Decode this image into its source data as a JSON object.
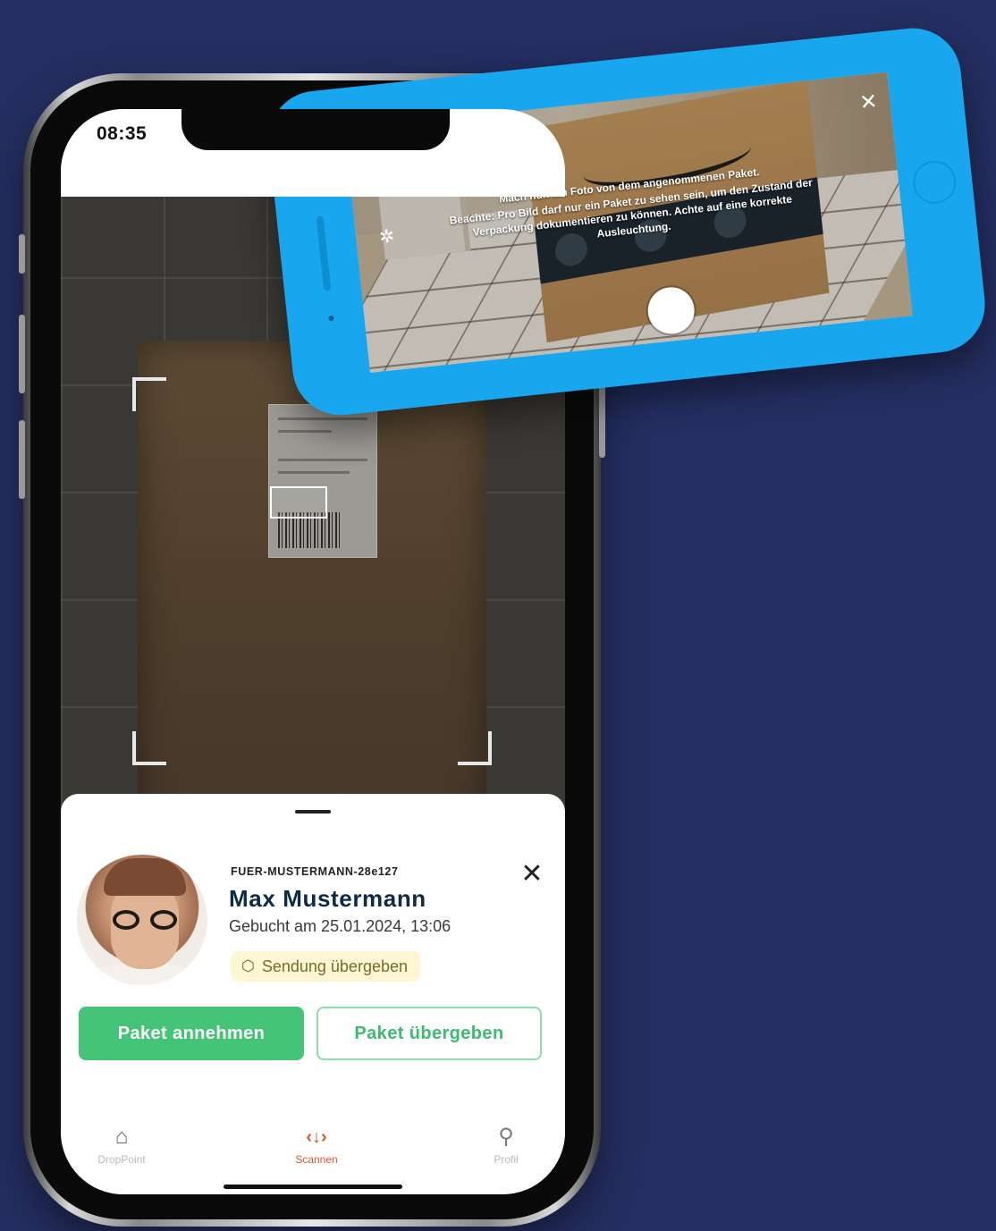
{
  "portrait_app": {
    "status_bar": {
      "time": "08:35"
    },
    "sheet": {
      "booking_id": "FUER-MUSTERMANN-28e127",
      "recipient_name": "Max Mustermann",
      "booked_at": "Gebucht am 25.01.2024, 13:06",
      "status_badge": {
        "icon": "package-icon",
        "label": "Sendung übergeben"
      },
      "close_icon": "close-icon",
      "buttons": {
        "accept": "Paket annehmen",
        "hand_over": "Paket übergeben"
      }
    },
    "tab_bar": {
      "items": [
        {
          "label": "DropPoint",
          "icon": "inbox-icon",
          "active": false
        },
        {
          "label": "Scannen",
          "icon": "scan-icon",
          "active": true
        },
        {
          "label": "Profil",
          "icon": "person-icon",
          "active": false
        }
      ]
    }
  },
  "landscape_app": {
    "instruction_line_1": "Mach nun ein Foto von dem angenommenen Paket.",
    "instruction_line_2": "Beachte: Pro Bild darf nur ein Paket zu sehen sein, um den Zustand der Verpackung dokumentieren zu können. Achte auf eine korrekte Ausleuchtung.",
    "close_icon": "close-icon",
    "flash_icon": "flash-icon",
    "shutter_icon": "shutter-button"
  },
  "colors": {
    "background": "#252f63",
    "primary_green": "#45c478",
    "active_tab": "#e0532f",
    "phone2_body": "#18a7ef",
    "badge_bg": "#fff7d4"
  }
}
